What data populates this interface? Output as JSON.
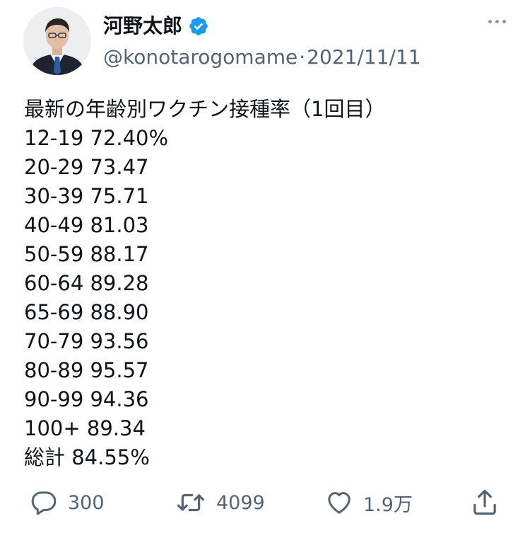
{
  "author": {
    "display_name": "河野太郎",
    "verified": true,
    "handle": "@konotarogomame",
    "separator": "·",
    "date": "2021/11/11"
  },
  "tweet": {
    "lines": [
      "最新の年齢別ワクチン接種率（1回目）",
      "12-19 72.40%",
      "20-29 73.47",
      "30-39 75.71",
      "40-49 81.03",
      "50-59 88.17",
      "60-64 89.28",
      "65-69 88.90",
      "70-79 93.56",
      "80-89 95.57",
      "90-99 94.36",
      "100+ 89.34",
      "総計 84.55%"
    ]
  },
  "actions": {
    "reply_count": "300",
    "retweet_count": "4099",
    "like_count": "1.9万"
  },
  "icons": {
    "verified": "verified-badge-icon",
    "more": "more-options-icon",
    "reply": "reply-icon",
    "retweet": "retweet-icon",
    "like": "heart-icon",
    "share": "share-icon"
  },
  "colors": {
    "verified_badge": "#1d9bf0",
    "text_primary": "#0f1419",
    "text_secondary": "#536471"
  }
}
